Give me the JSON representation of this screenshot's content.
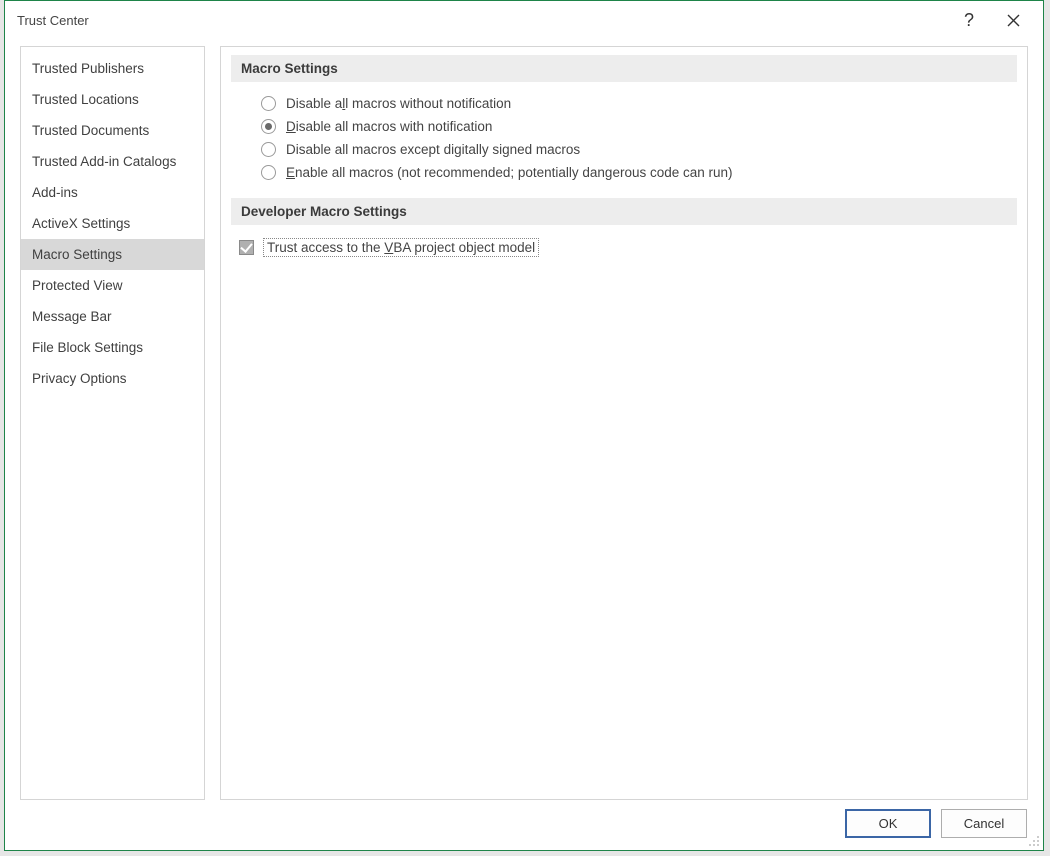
{
  "window": {
    "title": "Trust Center"
  },
  "sidebar": {
    "items": [
      {
        "label": "Trusted Publishers",
        "selected": false
      },
      {
        "label": "Trusted Locations",
        "selected": false
      },
      {
        "label": "Trusted Documents",
        "selected": false
      },
      {
        "label": "Trusted Add-in Catalogs",
        "selected": false
      },
      {
        "label": "Add-ins",
        "selected": false
      },
      {
        "label": "ActiveX Settings",
        "selected": false
      },
      {
        "label": "Macro Settings",
        "selected": true
      },
      {
        "label": "Protected View",
        "selected": false
      },
      {
        "label": "Message Bar",
        "selected": false
      },
      {
        "label": "File Block Settings",
        "selected": false
      },
      {
        "label": "Privacy Options",
        "selected": false
      }
    ]
  },
  "sections": {
    "macro": {
      "header": "Macro Settings",
      "options": [
        {
          "pre": "Disable a",
          "ukey": "l",
          "post": "l macros without notification",
          "checked": false
        },
        {
          "pre": "",
          "ukey": "D",
          "post": "isable all macros with notification",
          "checked": true
        },
        {
          "pre": "Disable all macros except digitally si",
          "ukey": "g",
          "post": "ned macros",
          "checked": false
        },
        {
          "pre": "",
          "ukey": "E",
          "post": "nable all macros (not recommended; potentially dangerous code can run)",
          "checked": false
        }
      ]
    },
    "dev": {
      "header": "Developer Macro Settings",
      "options": [
        {
          "pre": "Trust access to the ",
          "ukey": "V",
          "post": "BA project object model",
          "checked": true
        }
      ]
    }
  },
  "footer": {
    "ok": "OK",
    "cancel": "Cancel"
  }
}
